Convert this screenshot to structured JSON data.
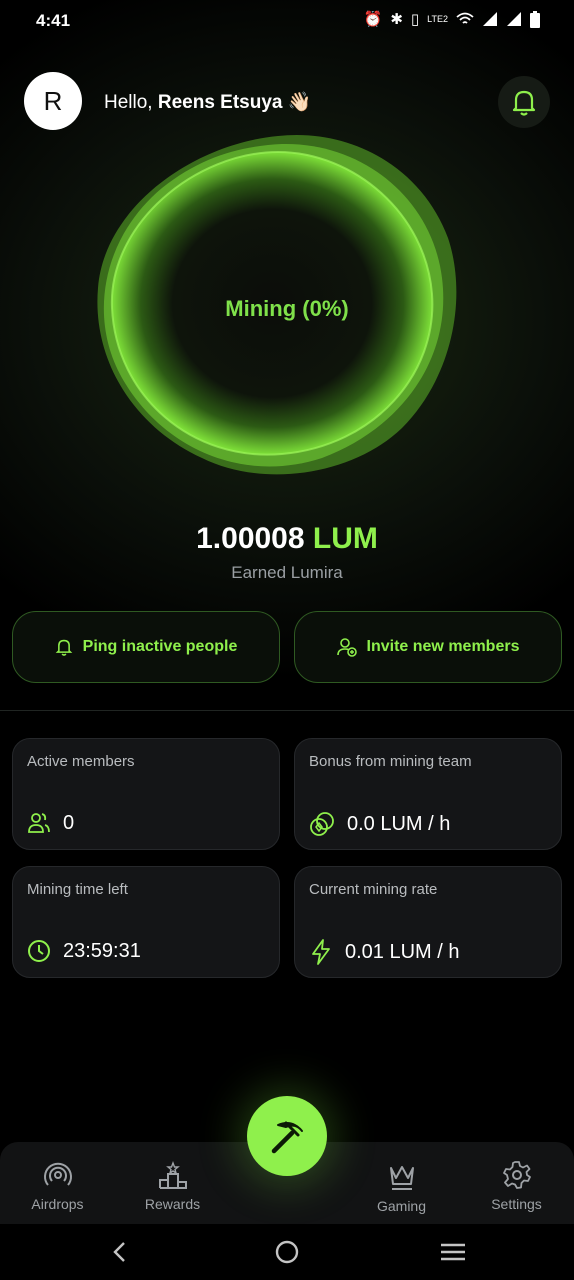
{
  "status": {
    "time": "4:41",
    "icons": [
      "alarm-icon",
      "bluetooth-icon",
      "vibrate-icon",
      "volte-icon",
      "wifi-icon",
      "signal-icon",
      "signal-icon",
      "battery-icon"
    ]
  },
  "header": {
    "avatar_letter": "R",
    "greeting_prefix": "Hello, ",
    "user_name": "Reens Etsuya",
    "emoji": "👋🏻"
  },
  "mining": {
    "status_label": "Mining (0%)",
    "progress_percent": 0
  },
  "balance": {
    "amount": "1.00008",
    "unit": "LUM",
    "caption": "Earned Lumira"
  },
  "actions": {
    "ping_label": "Ping inactive people",
    "invite_label": "Invite new members"
  },
  "stats": {
    "active_members": {
      "title": "Active members",
      "value": "0"
    },
    "bonus": {
      "title": "Bonus from mining team",
      "value": "0.0 LUM / h"
    },
    "time_left": {
      "title": "Mining time left",
      "value": "23:59:31"
    },
    "rate": {
      "title": "Current mining rate",
      "value": "0.01 LUM / h"
    }
  },
  "nav": {
    "airdrops": "Airdrops",
    "rewards": "Rewards",
    "gaming": "Gaming",
    "settings": "Settings"
  },
  "colors": {
    "accent": "#8ff04c",
    "background": "#000000",
    "card": "#141517"
  }
}
